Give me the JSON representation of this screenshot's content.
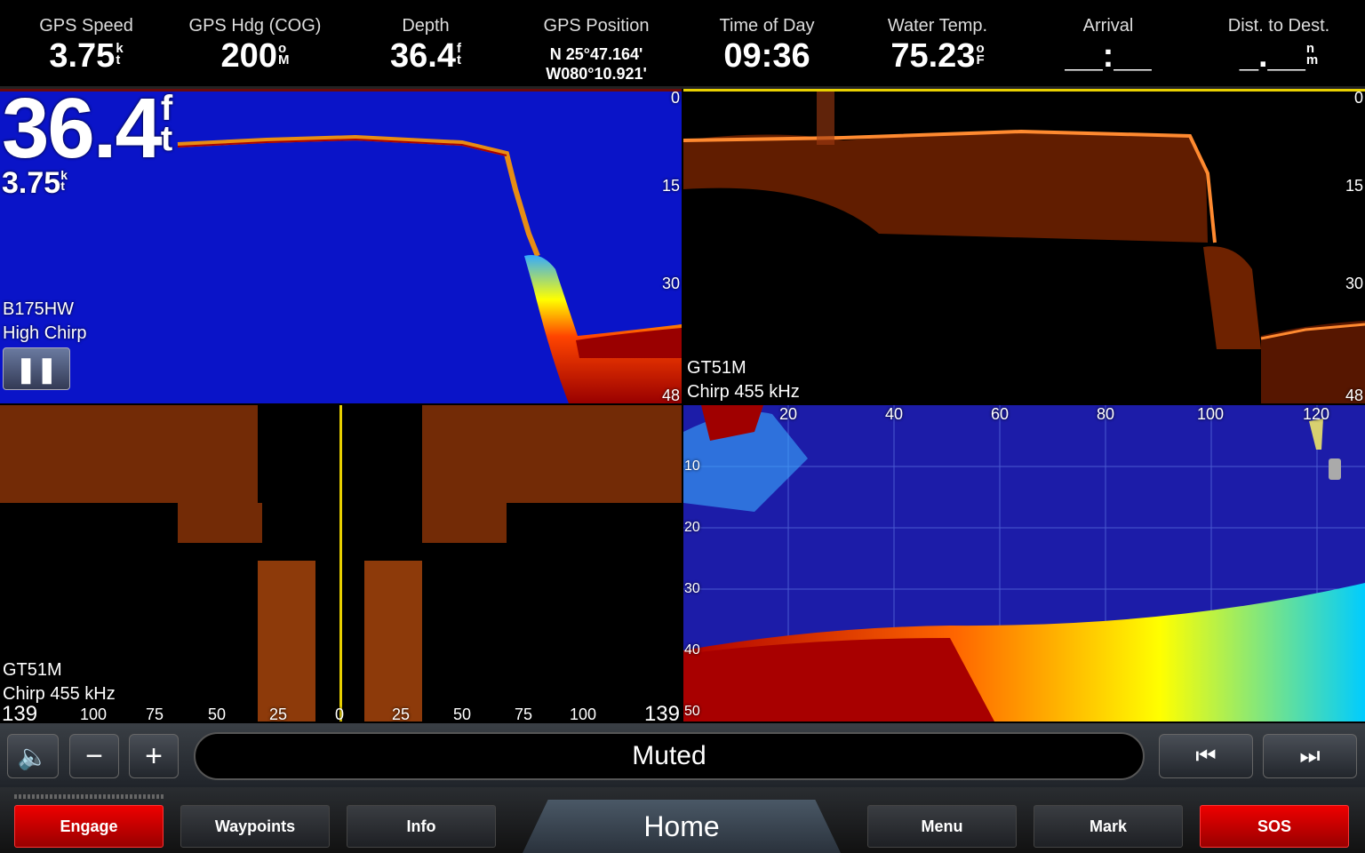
{
  "topbar": {
    "fields": [
      {
        "label": "GPS Speed",
        "value": "3.75",
        "unit_top": "k",
        "unit_bottom": "t"
      },
      {
        "label": "GPS Hdg (COG)",
        "value": "200",
        "unit_top": "o",
        "unit_bottom": "M"
      },
      {
        "label": "Depth",
        "value": "36.4",
        "unit_top": "f",
        "unit_bottom": "t"
      },
      {
        "label": "GPS Position",
        "lat": "N  25°47.164'",
        "lon": "W080°10.921'"
      },
      {
        "label": "Time of Day",
        "value": "09:36"
      },
      {
        "label": "Water Temp.",
        "value": "75.23",
        "unit_top": "o",
        "unit_bottom": "F"
      },
      {
        "label": "Arrival",
        "value": "__:__"
      },
      {
        "label": "Dist. to Dest.",
        "value": "_.__",
        "unit_top": "n",
        "unit_bottom": "m"
      }
    ]
  },
  "pane1": {
    "depth": "36.4",
    "depth_unit_top": "f",
    "depth_unit_bottom": "t",
    "speed": "3.75",
    "speed_unit_top": "k",
    "speed_unit_bottom": "t",
    "transducer": "B175HW",
    "mode": "High Chirp",
    "scale": [
      "0",
      "15",
      "30",
      "48"
    ]
  },
  "pane2": {
    "transducer": "GT51M",
    "mode": "Chirp 455 kHz",
    "scale": [
      "0",
      "15",
      "30",
      "48"
    ]
  },
  "pane3": {
    "transducer": "GT51M",
    "mode": "Chirp 455 kHz",
    "range_left": "139",
    "range_right": "139",
    "scale": [
      "100",
      "75",
      "50",
      "25",
      "0",
      "25",
      "50",
      "75",
      "100"
    ]
  },
  "pane4": {
    "x_scale": [
      "20",
      "40",
      "60",
      "80",
      "100",
      "120"
    ],
    "y_scale": [
      "10",
      "20",
      "30",
      "40",
      "50"
    ]
  },
  "media": {
    "status": "Muted"
  },
  "nav": {
    "engage": "Engage",
    "waypoints": "Waypoints",
    "info": "Info",
    "home": "Home",
    "menu": "Menu",
    "mark": "Mark",
    "sos": "SOS"
  },
  "colors": {
    "accent_red": "#e00000",
    "sonar_blue": "#0a14c8",
    "cursor_yellow": "#e8d000"
  }
}
